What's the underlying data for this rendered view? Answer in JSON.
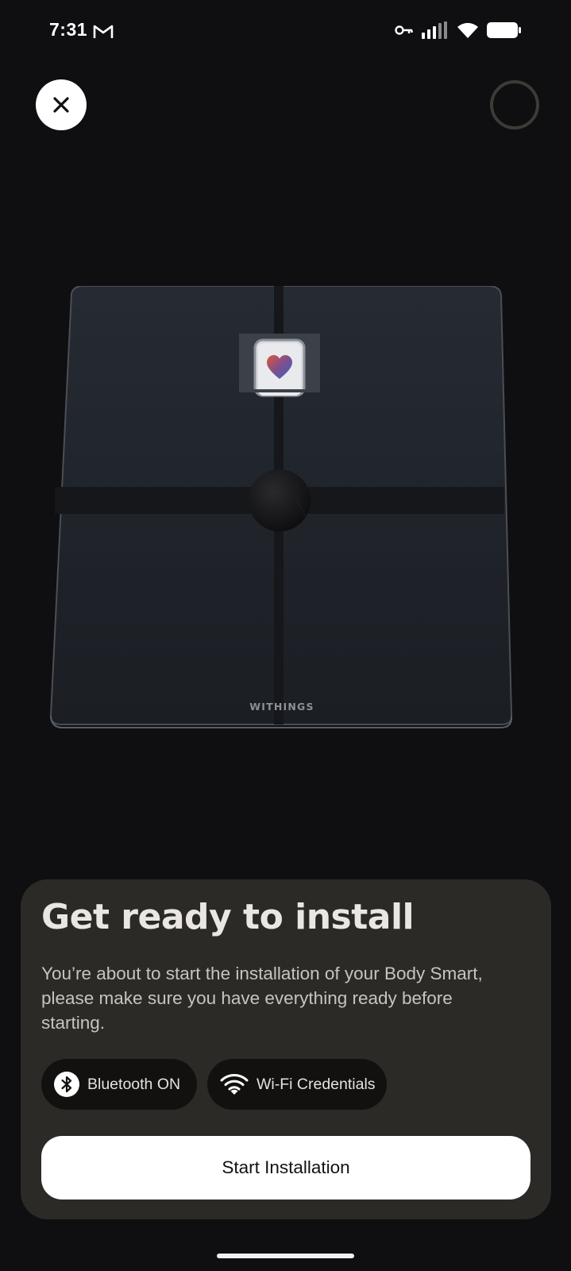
{
  "status_bar": {
    "time": "7:31",
    "icons": [
      "gmail-icon",
      "vpn-key-icon",
      "signal-icon",
      "wifi-icon",
      "battery-icon"
    ]
  },
  "header": {
    "close_icon": "close-icon",
    "progress_icon": "progress-ring-icon"
  },
  "illustration": {
    "brand_text": "WITHINGS",
    "screen_icon": "heart-icon"
  },
  "sheet": {
    "title": "Get ready to install",
    "description": "You’re about to start the installation of your Body Smart, please make sure you have everything ready before starting.",
    "requirements": [
      {
        "icon": "bluetooth-icon",
        "label": "Bluetooth ON"
      },
      {
        "icon": "wifi-icon",
        "label": "Wi-Fi Credentials"
      }
    ],
    "start_button_label": "Start Installation"
  },
  "colors": {
    "background": "#0f0e10",
    "sheet": "#2c2a27",
    "chip": "#121110",
    "button": "#ffffff"
  }
}
